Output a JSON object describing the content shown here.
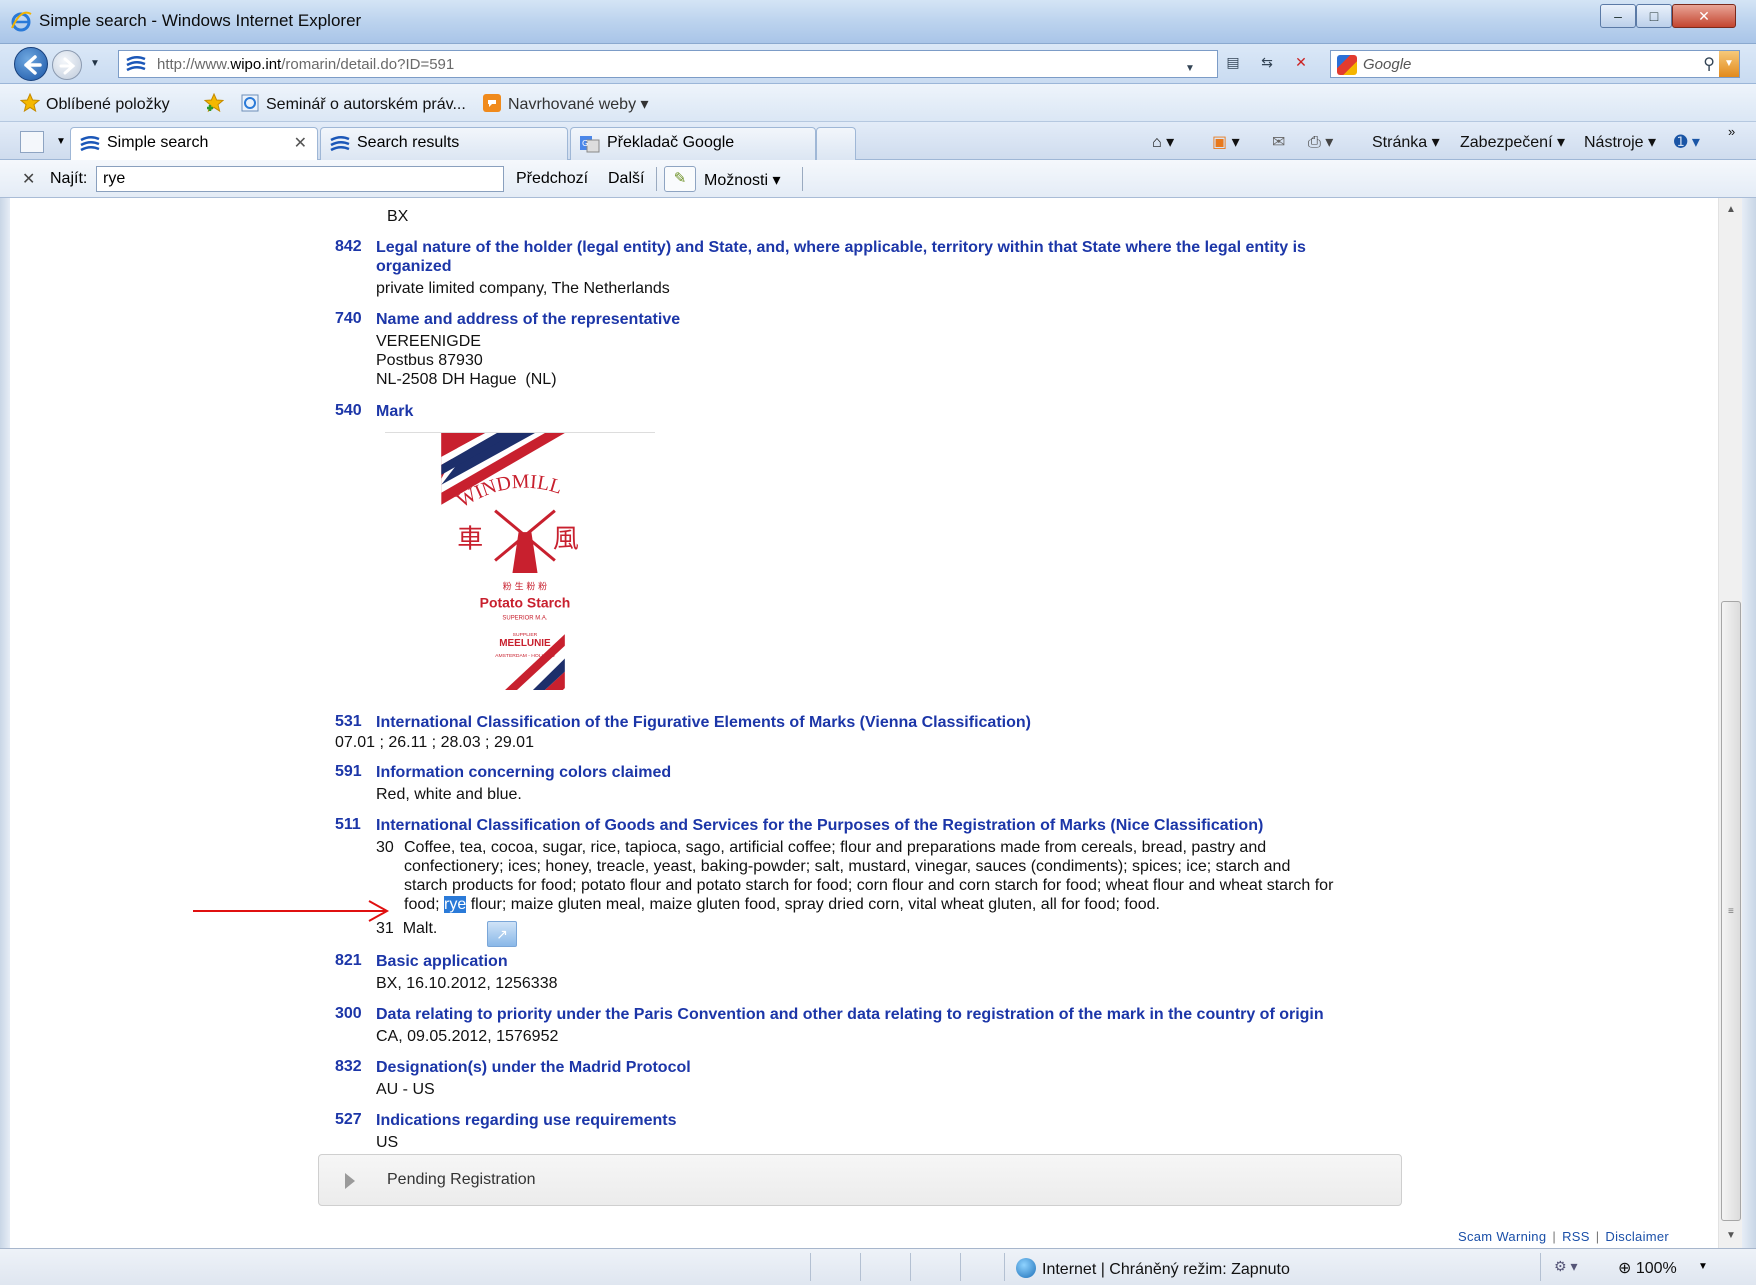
{
  "window": {
    "title": "Simple search - Windows Internet Explorer",
    "controls": {
      "minimize": "‒",
      "maximize": "□",
      "close": "✕"
    }
  },
  "address_bar": {
    "url_prefix": "http://www.",
    "url_domain": "wipo.int",
    "url_path": "/romarin/detail.do?ID=591",
    "search_placeholder": "Google"
  },
  "favorites_bar": {
    "favorites_label": "Oblíbené položky",
    "link1": "Seminář o autorském práv...",
    "link2": "Navrhované weby"
  },
  "tabs": [
    {
      "label": "Simple search",
      "active": true
    },
    {
      "label": "Search results",
      "active": false
    },
    {
      "label": "Překladač Google",
      "active": false
    }
  ],
  "command_bar": {
    "page": "Stránka",
    "safety": "Zabezpečení",
    "tools": "Nástroje"
  },
  "find_bar": {
    "label": "Najít:",
    "value": "rye",
    "previous": "Předchozí",
    "next": "Další",
    "options": "Možnosti"
  },
  "record": {
    "top_value": "BX",
    "fields": [
      {
        "code": "842",
        "title": "Legal nature of the holder (legal entity) and State, and, where applicable, territory within that State where the legal entity is organized",
        "value": "private limited company, The Netherlands"
      },
      {
        "code": "740",
        "title": "Name and address of the representative",
        "lines": [
          "VEREENIGDE",
          "Postbus 87930",
          "NL-2508 DH Hague  (NL)"
        ]
      },
      {
        "code": "540",
        "title": "Mark"
      },
      {
        "code": "531",
        "title": "International Classification of the Figurative Elements of Marks (Vienna Classification)",
        "value": "07.01 ; 26.11 ; 28.03 ; 29.01"
      },
      {
        "code": "591",
        "title": "Information concerning colors claimed",
        "value": "Red, white and blue."
      },
      {
        "code": "511",
        "title": "International Classification of Goods and Services for the Purposes of the Registration of Marks (Nice Classification)"
      },
      {
        "code": "821",
        "title": "Basic application",
        "value": "BX, 16.10.2012, 1256338"
      },
      {
        "code": "300",
        "title": "Data relating to priority under the Paris Convention and other data relating to registration of the mark in the country of origin",
        "value": "CA, 09.05.2012, 1576952"
      },
      {
        "code": "832",
        "title": "Designation(s) under the Madrid Protocol",
        "value": "AU - US"
      },
      {
        "code": "527",
        "title": "Indications regarding use requirements",
        "value": "US"
      }
    ],
    "nice_classes": {
      "class30_num": "30",
      "class30_line1": "Coffee, tea, cocoa, sugar, rice, tapioca, sago, artificial coffee; flour and preparations made from cereals, bread, pastry and",
      "class30_line2": "confectionery; ices; honey, treacle, yeast, baking-powder; salt, mustard, vinegar, sauces (condiments); spices; ice; starch and",
      "class30_line3": "starch products for food; potato flour and potato starch for food; corn flour and corn starch for food; wheat flour and wheat starch for",
      "class30_line4_pre": "food; ",
      "class30_line4_hl": "rye",
      "class30_line4_post": " flour; maize gluten meal, maize gluten food, spray dried corn, vital wheat gluten, all for food; food.",
      "class31_num": "31",
      "class31_text": "Malt."
    },
    "mark_logo": {
      "word": "WINDMILL",
      "chinese": "車 風",
      "chinese_small": "粉 生 粉 粉",
      "product": "Potato Starch",
      "grade": "SUPERIOR M.A.",
      "supplier_label": "SUPPLIER",
      "supplier": "MEELUNIE",
      "city": "AMSTERDAM - HOLLAND",
      "colors": {
        "red": "#c8202e",
        "blue": "#1d2f6b",
        "stripe_white": "#ffffff"
      }
    }
  },
  "pending": {
    "label": "Pending Registration"
  },
  "footer": {
    "scam": "Scam Warning",
    "rss": "RSS",
    "disclaimer": "Disclaimer"
  },
  "status_bar": {
    "zone": "Internet | Chráněný režim: Zapnuto",
    "zoom": "100%"
  },
  "colors": {
    "field_title": "#1c36a8",
    "highlight": "#2a7ad8",
    "annotation_arrow": "#e01010"
  }
}
